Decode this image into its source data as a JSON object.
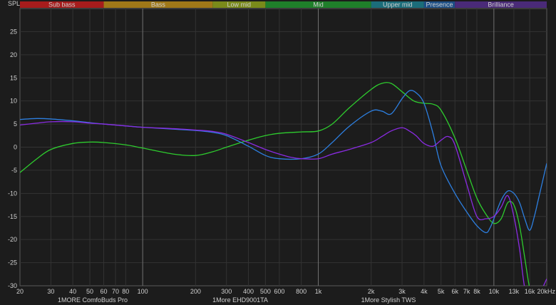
{
  "chart_data": {
    "type": "line",
    "ylabel": "SPL",
    "ylim": [
      -30,
      30
    ],
    "xlim": [
      20,
      20000
    ],
    "x_scale": "log",
    "y_ticks": [
      25,
      20,
      15,
      10,
      5,
      0,
      -5,
      -10,
      -15,
      -20,
      -25,
      -30
    ],
    "x_ticks": [
      {
        "v": 20,
        "label": "20",
        "major": false
      },
      {
        "v": 30,
        "label": "30",
        "major": false
      },
      {
        "v": 40,
        "label": "40",
        "major": false
      },
      {
        "v": 50,
        "label": "50",
        "major": false
      },
      {
        "v": 60,
        "label": "60",
        "major": false
      },
      {
        "v": 70,
        "label": "70",
        "major": false
      },
      {
        "v": 80,
        "label": "80",
        "major": false
      },
      {
        "v": 100,
        "label": "100",
        "major": true
      },
      {
        "v": 200,
        "label": "200",
        "major": false
      },
      {
        "v": 300,
        "label": "300",
        "major": false
      },
      {
        "v": 400,
        "label": "400",
        "major": false
      },
      {
        "v": 500,
        "label": "500",
        "major": false
      },
      {
        "v": 600,
        "label": "600",
        "major": false
      },
      {
        "v": 800,
        "label": "800",
        "major": false
      },
      {
        "v": 1000,
        "label": "1k",
        "major": true
      },
      {
        "v": 2000,
        "label": "2k",
        "major": false
      },
      {
        "v": 3000,
        "label": "3k",
        "major": false
      },
      {
        "v": 4000,
        "label": "4k",
        "major": false
      },
      {
        "v": 5000,
        "label": "5k",
        "major": false
      },
      {
        "v": 6000,
        "label": "6k",
        "major": false
      },
      {
        "v": 7000,
        "label": "7k",
        "major": false
      },
      {
        "v": 8000,
        "label": "8k",
        "major": false
      },
      {
        "v": 10000,
        "label": "10k",
        "major": true
      },
      {
        "v": 13000,
        "label": "13k",
        "major": false,
        "dim": true
      },
      {
        "v": 16000,
        "label": "16k",
        "major": false,
        "dim": true
      },
      {
        "v": 20000,
        "label": "20kHz",
        "major": false
      }
    ],
    "bands": [
      {
        "label": "Sub bass",
        "from": 20,
        "to": 60,
        "color": "#a61c1c"
      },
      {
        "label": "Bass",
        "from": 60,
        "to": 250,
        "color": "#a07818"
      },
      {
        "label": "Low mid",
        "from": 250,
        "to": 500,
        "color": "#7a8a1a"
      },
      {
        "label": "Mid",
        "from": 500,
        "to": 2000,
        "color": "#1f7f2a"
      },
      {
        "label": "Upper mid",
        "from": 2000,
        "to": 4000,
        "color": "#1b6d7a"
      },
      {
        "label": "Presence",
        "from": 4000,
        "to": 6000,
        "color": "#1d4f86"
      },
      {
        "label": "Brilliance",
        "from": 6000,
        "to": 20000,
        "color": "#4a2a78"
      }
    ],
    "series": [
      {
        "name": "1MORE ComfoBuds Pro",
        "color": "#2ecc2e",
        "x": [
          20,
          25,
          30,
          40,
          50,
          60,
          80,
          100,
          150,
          200,
          250,
          300,
          400,
          500,
          600,
          800,
          1000,
          1200,
          1500,
          2000,
          2300,
          2600,
          3000,
          3500,
          4000,
          4500,
          5000,
          6000,
          7000,
          8000,
          9000,
          10000,
          11000,
          12000,
          13000,
          14000,
          15000,
          16000,
          17000,
          18000,
          20000
        ],
        "values": [
          -5.5,
          -2.5,
          -0.5,
          0.8,
          1.1,
          1.0,
          0.5,
          -0.2,
          -1.5,
          -1.8,
          -1.0,
          0.0,
          1.5,
          2.5,
          3.0,
          3.3,
          3.5,
          5.0,
          8.5,
          12.5,
          13.8,
          13.8,
          12.0,
          10.0,
          9.5,
          9.3,
          8.0,
          2.0,
          -5.0,
          -11.0,
          -14.5,
          -16.5,
          -15.5,
          -12.0,
          -12.5,
          -17.0,
          -24.0,
          -30.5,
          -32,
          -32,
          -32
        ]
      },
      {
        "name": "1More EHD9001TA",
        "color": "#2d7fe0",
        "x": [
          20,
          25,
          30,
          40,
          50,
          60,
          80,
          100,
          150,
          200,
          250,
          300,
          400,
          500,
          600,
          800,
          1000,
          1200,
          1500,
          2000,
          2300,
          2600,
          3000,
          3300,
          3600,
          4000,
          4500,
          5000,
          6000,
          7000,
          8000,
          9000,
          9500,
          10000,
          11000,
          12000,
          13000,
          14000,
          15000,
          16000,
          17000,
          18000,
          20000
        ],
        "values": [
          6.0,
          6.2,
          6.1,
          5.7,
          5.3,
          5.0,
          4.6,
          4.3,
          3.9,
          3.6,
          3.2,
          2.5,
          0.2,
          -1.8,
          -2.5,
          -2.5,
          -1.5,
          1.0,
          4.5,
          7.8,
          7.8,
          7.2,
          10.5,
          12.2,
          11.8,
          9.5,
          3.0,
          -4.0,
          -10.0,
          -14.0,
          -17.0,
          -18.5,
          -17.5,
          -15.5,
          -11.5,
          -9.5,
          -10.0,
          -12.0,
          -15.5,
          -18.0,
          -15.0,
          -11.0,
          -3.5
        ]
      },
      {
        "name": "1More Stylish TWS",
        "color": "#8a2be2",
        "x": [
          20,
          25,
          30,
          40,
          50,
          60,
          80,
          100,
          150,
          200,
          250,
          300,
          400,
          500,
          600,
          700,
          800,
          1000,
          1200,
          1500,
          2000,
          2300,
          2600,
          3000,
          3300,
          3600,
          4000,
          4500,
          5000,
          5500,
          6000,
          7000,
          8000,
          9000,
          10000,
          11000,
          12000,
          13000,
          14000,
          15000,
          16000,
          17000,
          18000,
          20000
        ],
        "values": [
          4.8,
          5.2,
          5.5,
          5.5,
          5.2,
          5.0,
          4.6,
          4.3,
          4.0,
          3.7,
          3.4,
          2.8,
          1.0,
          -0.5,
          -1.5,
          -2.2,
          -2.5,
          -2.5,
          -1.5,
          -0.5,
          1.0,
          2.3,
          3.5,
          4.2,
          3.5,
          2.5,
          0.8,
          0.2,
          1.5,
          2.3,
          0.5,
          -8.0,
          -15.0,
          -15.5,
          -15.0,
          -13.0,
          -10.5,
          -15.0,
          -22.0,
          -30.5,
          -31.5,
          -32,
          -32,
          -28.5
        ]
      }
    ]
  }
}
